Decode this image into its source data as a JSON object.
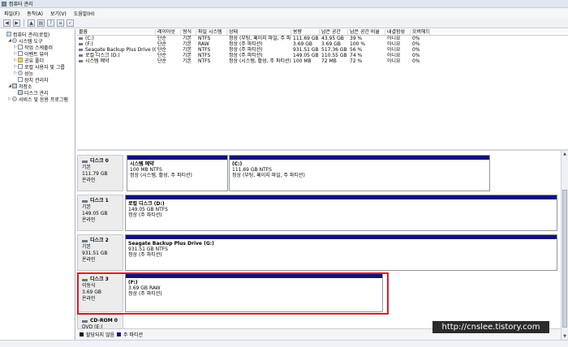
{
  "window": {
    "title": "컴퓨터 관리"
  },
  "menu": [
    "파일(F)",
    "동작(A)",
    "보기(V)",
    "도움말(H)"
  ],
  "toolbar": {
    "buttons": [
      "back-icon",
      "forward-icon",
      "up-icon",
      "properties-icon",
      "help-icon",
      "list-icon",
      "checkmark-icon"
    ]
  },
  "tree": [
    {
      "label": "컴퓨터 관리(로컬)",
      "indent": 0,
      "tri": "",
      "icon": "computer"
    },
    {
      "label": "시스템 도구",
      "indent": 1,
      "tri": "◢",
      "icon": "gear"
    },
    {
      "label": "작업 스케줄러",
      "indent": 2,
      "tri": "▷",
      "icon": "log"
    },
    {
      "label": "이벤트 뷰어",
      "indent": 2,
      "tri": "▷",
      "icon": "log"
    },
    {
      "label": "공유 폴더",
      "indent": 2,
      "tri": "▷",
      "icon": "folder"
    },
    {
      "label": "로컬 사용자 및 그룹",
      "indent": 2,
      "tri": "▷",
      "icon": "log"
    },
    {
      "label": "성능",
      "indent": 2,
      "tri": "▷",
      "icon": "gear"
    },
    {
      "label": "장치 관리자",
      "indent": 2,
      "tri": "",
      "icon": "log"
    },
    {
      "label": "저장소",
      "indent": 1,
      "tri": "◢",
      "icon": "disk"
    },
    {
      "label": "디스크 관리",
      "indent": 2,
      "tri": "",
      "icon": "disk"
    },
    {
      "label": "서비스 및 응용 프로그램",
      "indent": 1,
      "tri": "▷",
      "icon": "gear"
    }
  ],
  "volumes": {
    "headers": [
      "볼륨",
      "레이아웃",
      "형식",
      "파일 시스템",
      "상태",
      "용량",
      "남은 공간",
      "남은 공간 비율",
      "내결함성",
      "오버헤드"
    ],
    "rows": [
      [
        "(C:)",
        "단순",
        "기본",
        "NTFS",
        "정상 (부팅, 페이지 파일, 주 파티션)",
        "111.69 GB",
        "43.95 GB",
        "39 %",
        "아니요",
        "0%"
      ],
      [
        "(F:)",
        "단순",
        "기본",
        "RAW",
        "정상 (주 파티션)",
        "3.69 GB",
        "3.69 GB",
        "100 %",
        "아니요",
        "0%"
      ],
      [
        "Seagate Backup Plus Drive (G:)",
        "단순",
        "기본",
        "NTFS",
        "정상 (주 파티션)",
        "931.51 GB",
        "517.36 GB",
        "56 %",
        "아니요",
        "0%"
      ],
      [
        "로컬 디스크 (D:)",
        "단순",
        "기본",
        "NTFS",
        "정상 (주 파티션)",
        "149.05 GB",
        "110.55 GB",
        "74 %",
        "아니요",
        "0%"
      ],
      [
        "시스템 예약",
        "단순",
        "기본",
        "NTFS",
        "정상 (시스템, 활성, 주 파티션)",
        "100 MB",
        "72 MB",
        "72 %",
        "아니요",
        "0%"
      ]
    ]
  },
  "disks": [
    {
      "name": "디스크 0",
      "type": "기본",
      "size": "111.79 GB",
      "status": "온라인",
      "partitions": [
        {
          "title": "시스템 예약",
          "line1": "100 MB NTFS",
          "line2": "정상 (시스템, 활성, 주 파티션)"
        },
        {
          "title": "(C:)",
          "line1": "111.69 GB NTFS",
          "line2": "정상 (부팅, 페이지 파일, 주 파티션)"
        }
      ]
    },
    {
      "name": "디스크 1",
      "type": "기본",
      "size": "149.05 GB",
      "status": "온라인",
      "partitions": [
        {
          "title": "로컬 디스크 (D:)",
          "line1": "149.05 GB NTFS",
          "line2": "정상 (주 파티션)"
        }
      ]
    },
    {
      "name": "디스크 2",
      "type": "기본",
      "size": "931.51 GB",
      "status": "온라인",
      "partitions": [
        {
          "title": "Seagate Backup Plus Drive (G:)",
          "line1": "931.51 GB NTFS",
          "line2": "정상 (주 파티션)"
        }
      ]
    },
    {
      "name": "디스크 3",
      "type": "이동식",
      "size": "3.69 GB",
      "status": "온라인",
      "partitions": [
        {
          "title": "(F:)",
          "line1": "3.69 GB RAW",
          "line2": "정상 (주 파티션)"
        }
      ]
    },
    {
      "name": "CD-ROM 0",
      "type": "DVD (E:)",
      "size": "",
      "status": "",
      "partitions": []
    }
  ],
  "legend": {
    "unallocated": "할당되지 않음",
    "primary": "주 파티션"
  },
  "watermark": "http://cnslee.tistory.com"
}
